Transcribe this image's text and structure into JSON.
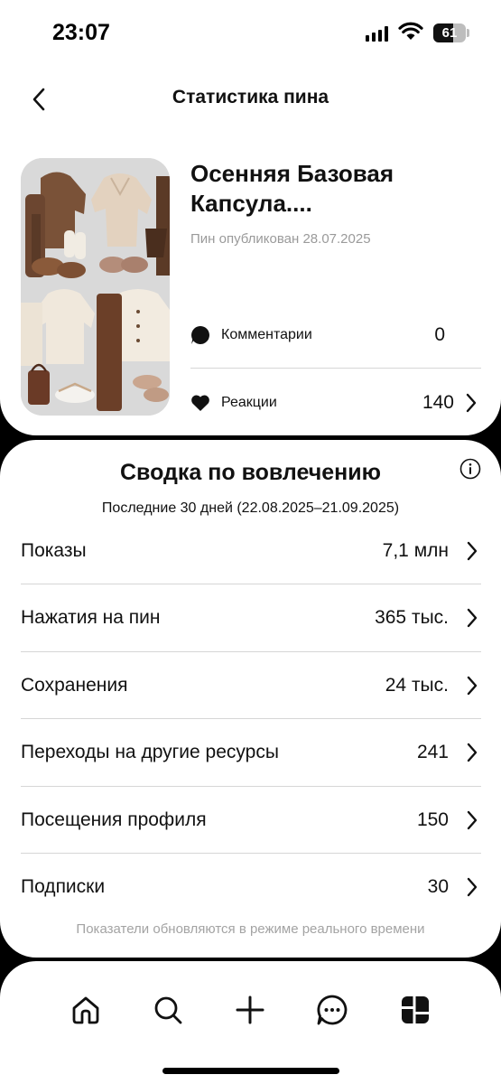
{
  "status_bar": {
    "time": "23:07",
    "battery_percent": 61,
    "battery_label": "61"
  },
  "header": {
    "title": "Статистика пина",
    "back_icon": "chevron-left-icon"
  },
  "pin": {
    "title_line1": "Осенняя Базовая",
    "title_line2": "Капсула....",
    "published": "Пин опубликован 28.07.2025",
    "stats": [
      {
        "label": "Комментарии",
        "value": "0",
        "icon": "comment-bubble-icon"
      },
      {
        "label": "Реакции",
        "value": "140",
        "icon": "heart-icon"
      }
    ]
  },
  "engagement": {
    "title": "Сводка по вовлечению",
    "period": "Последние 30 дней (22.08.2025–21.09.2025)",
    "metrics": [
      {
        "label": "Показы",
        "value": "7,1 млн"
      },
      {
        "label": "Нажатия на пин",
        "value": "365 тыс."
      },
      {
        "label": "Сохранения",
        "value": "24 тыс."
      },
      {
        "label": "Переходы на другие ресурсы",
        "value": "241"
      },
      {
        "label": "Посещения профиля",
        "value": "150"
      },
      {
        "label": "Подписки",
        "value": "30"
      }
    ],
    "footnote": "Показатели обновляются в режиме реального времени"
  },
  "nav": {
    "items": [
      "home-icon",
      "search-icon",
      "plus-icon",
      "messages-icon",
      "dashboard-icon"
    ]
  },
  "colors": {
    "background": "#000000",
    "card": "#ffffff",
    "divider": "#d6d6d6",
    "muted_text": "#9a9a9a"
  }
}
